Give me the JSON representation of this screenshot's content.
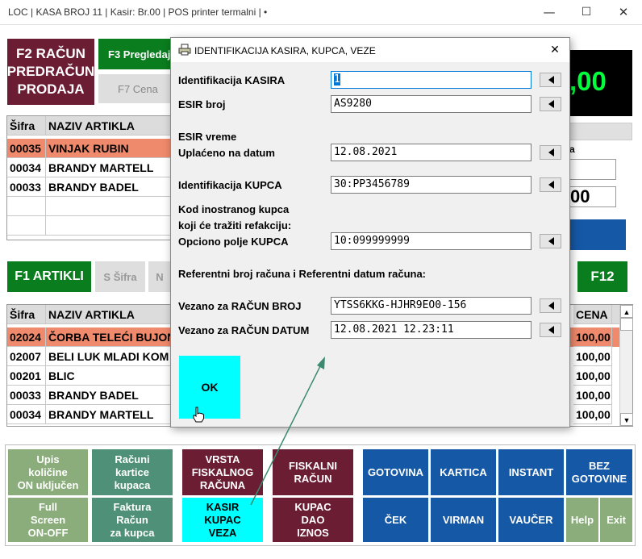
{
  "window": {
    "title": "LOC | KASA BROJ 11 | Kasir:  Br.00 | POS printer termalni |  •",
    "minimize_glyph": "—",
    "maximize_glyph": "☐",
    "close_glyph": "✕"
  },
  "top_buttons": {
    "f2_line1": "F2 RAČUN",
    "f2_line2": "PREDRAČUN",
    "f2_line3": "PRODAJA",
    "f3": "F3 Pregledaj",
    "f7": "F7 Cena"
  },
  "total_display": {
    "value": ",00"
  },
  "right_panel": {
    "partial_label": "a",
    "partial_value": "00"
  },
  "cart_table": {
    "headers": [
      "Šifra",
      "NAZIV ARTIKLA"
    ],
    "rows": [
      {
        "code": "00035",
        "name": "VINJAK RUBIN"
      },
      {
        "code": "00034",
        "name": "BRANDY MARTELL"
      },
      {
        "code": "00033",
        "name": "BRANDY BADEL"
      }
    ]
  },
  "articles_bar": {
    "f1": "F1 ARTIKLI",
    "sifra": "S Šifra",
    "n": "N",
    "f12": "F12"
  },
  "articles_table": {
    "headers": [
      "Šifra",
      "NAZIV ARTIKLA",
      "CENA"
    ],
    "rows": [
      {
        "code": "02024",
        "name": "ČORBA TELEĆI BUJON",
        "price": "100,00"
      },
      {
        "code": "02007",
        "name": "BELI LUK MLADI KOM",
        "price": "100,00"
      },
      {
        "code": "00201",
        "name": "BLIC",
        "price": "100,00"
      },
      {
        "code": "00033",
        "name": "BRANDY BADEL",
        "price": "100,00"
      },
      {
        "code": "00034",
        "name": "BRANDY MARTELL",
        "price": "100,00"
      }
    ]
  },
  "bottom_buttons": {
    "upis": [
      "Upis",
      "količine",
      "ON uključen"
    ],
    "racuni": [
      "Računi",
      "kartice",
      "kupaca"
    ],
    "vrsta": [
      "VRSTA",
      "FISKALNOG",
      "RAČUNA"
    ],
    "fiskalni": [
      "FISKALNI",
      "RAČUN"
    ],
    "gotovina": "GOTOVINA",
    "kartica": "KARTICA",
    "instant": "INSTANT",
    "bez": [
      "BEZ",
      "GOTOVINE"
    ],
    "full": [
      "Full",
      "Screen",
      "ON-OFF"
    ],
    "faktura": [
      "Faktura",
      "Račun",
      "za kupca"
    ],
    "kasir": [
      "KASIR",
      "KUPAC",
      "VEZA"
    ],
    "kupac": [
      "KUPAC",
      "DAO",
      "IZNOS"
    ],
    "cek": "ČEK",
    "virman": "VIRMAN",
    "vaucer": "VAUČER",
    "help": "Help",
    "exit": "Exit"
  },
  "dialog": {
    "title": "IDENTIFIKACIJA KASIRA, KUPCA, VEZE",
    "close_glyph": "✕",
    "labels": {
      "kasir_id": "Identifikacija KASIRA",
      "esir": "ESIR broj",
      "esir_vreme": "ESIR vreme",
      "uplaceno": "Uplaćeno na datum",
      "kupac_id": "Identifikacija KUPCA",
      "kod_line1": "Kod inostranog kupca",
      "kod_line2": "koji će tražiti refakciju:",
      "opciono": "Opciono polje KUPCA",
      "referentni": "Referentni broj računa i Referentni datum računa:",
      "vezano_broj": "Vezano za RAČUN BROJ",
      "vezano_datum": "Vezano za RAČUN DATUM"
    },
    "values": {
      "kasir_id": "1",
      "esir": "AS9280",
      "uplaceno": "12.08.2021",
      "kupac_id": "30:PP3456789",
      "opciono": "10:099999999",
      "vezano_broj": "YTSS6KKG-HJHR9EO0-156",
      "vezano_datum": "12.08.2021 12.23:11"
    },
    "ok_label": "OK"
  },
  "colors": {
    "dark_red": "#6b1d33",
    "green": "#0a7d1e",
    "sage": "#8aad7b",
    "teal": "#4f9178",
    "blue": "#1558a6",
    "cyan": "#00ffff",
    "highlight": "#f08a6c"
  }
}
